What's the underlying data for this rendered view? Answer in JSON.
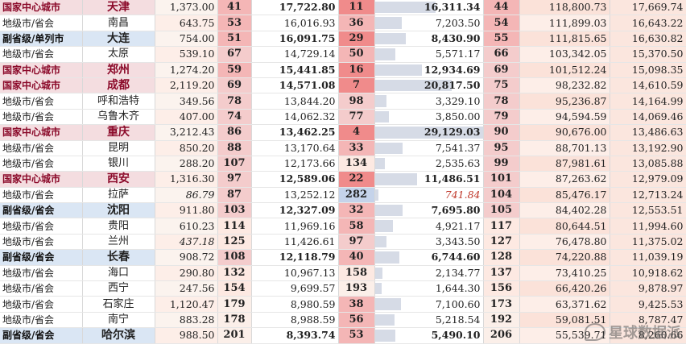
{
  "colors": {
    "national": "#f4dde0",
    "subprov": "#dae6f4",
    "prefect": "#ffffff",
    "rank_high": "#f4cccc",
    "rank_low": "#fde9e2",
    "value_bar": "#d6dbe6"
  },
  "rows": [
    {
      "cat": "国家中心城市",
      "type": "national",
      "city": "天津",
      "v1": "1,373.00",
      "r1": "41",
      "v2": "17,722.80",
      "r2": "11",
      "v3": "16,311.34",
      "r3": "44",
      "v4": "118,800.73",
      "v5": "17,669.74"
    },
    {
      "cat": "地级市/省会",
      "type": "prefect",
      "city": "南昌",
      "v1": "643.75",
      "r1": "53",
      "v2": "16,016.93",
      "r2": "36",
      "v3": "7,203.50",
      "r3": "54",
      "v4": "111,899.03",
      "v5": "16,643.22"
    },
    {
      "cat": "副省级/单列市",
      "type": "subprov",
      "city": "大连",
      "v1": "754.00",
      "r1": "51",
      "v2": "16,091.75",
      "r2": "29",
      "v3": "8,430.90",
      "r3": "55",
      "v4": "111,815.65",
      "v5": "16,630.82"
    },
    {
      "cat": "地级市/省会",
      "type": "prefect",
      "city": "太原",
      "v1": "539.10",
      "r1": "67",
      "v2": "14,729.14",
      "r2": "50",
      "v3": "5,571.17",
      "r3": "66",
      "v4": "103,342.05",
      "v5": "15,370.50"
    },
    {
      "cat": "国家中心城市",
      "type": "national",
      "city": "郑州",
      "v1": "1,274.20",
      "r1": "59",
      "v2": "15,441.85",
      "r2": "16",
      "v3": "12,934.69",
      "r3": "69",
      "v4": "101,512.24",
      "v5": "15,098.35"
    },
    {
      "cat": "国家中心城市",
      "type": "national",
      "city": "成都",
      "v1": "2,119.20",
      "r1": "69",
      "v2": "14,571.08",
      "r2": "7",
      "v3": "20,817.50",
      "r3": "75",
      "v4": "98,232.82",
      "v5": "14,610.59"
    },
    {
      "cat": "地级市/省会",
      "type": "prefect",
      "city": "呼和浩特",
      "v1": "349.56",
      "r1": "78",
      "v2": "13,844.20",
      "r2": "98",
      "v3": "3,329.10",
      "r3": "78",
      "v4": "95,236.87",
      "v5": "14,164.99"
    },
    {
      "cat": "地级市/省会",
      "type": "prefect",
      "city": "乌鲁木齐",
      "v1": "407.00",
      "r1": "74",
      "v2": "14,062.32",
      "r2": "77",
      "v3": "3,850.00",
      "r3": "79",
      "v4": "94,594.59",
      "v5": "14,069.46"
    },
    {
      "cat": "国家中心城市",
      "type": "national",
      "city": "重庆",
      "v1": "3,212.43",
      "r1": "86",
      "v2": "13,462.25",
      "r2": "4",
      "v3": "29,129.03",
      "r3": "90",
      "v4": "90,676.00",
      "v5": "13,486.63"
    },
    {
      "cat": "地级市/省会",
      "type": "prefect",
      "city": "昆明",
      "v1": "850.20",
      "r1": "88",
      "v2": "13,170.64",
      "r2": "33",
      "v3": "7,541.37",
      "r3": "95",
      "v4": "88,701.13",
      "v5": "13,192.90"
    },
    {
      "cat": "地级市/省会",
      "type": "prefect",
      "city": "银川",
      "v1": "288.20",
      "r1": "107",
      "v2": "12,173.66",
      "r2": "134",
      "v3": "2,535.63",
      "r3": "99",
      "v4": "87,981.61",
      "v5": "13,085.88"
    },
    {
      "cat": "国家中心城市",
      "type": "national",
      "city": "西安",
      "v1": "1,316.30",
      "r1": "97",
      "v2": "12,589.06",
      "r2": "22",
      "v3": "11,486.51",
      "r3": "101",
      "v4": "87,263.62",
      "v5": "12,979.09"
    },
    {
      "cat": "地级市/省会",
      "type": "prefect",
      "city": "拉萨",
      "v1": "86.79",
      "r1": "87",
      "v2": "13,252.12",
      "r2": "282",
      "v3": "741.84",
      "r3": "104",
      "v4": "85,476.17",
      "v5": "12,713.24"
    },
    {
      "cat": "副省级/省会",
      "type": "subprov",
      "city": "沈阳",
      "v1": "911.80",
      "r1": "103",
      "v2": "12,327.09",
      "r2": "32",
      "v3": "7,695.80",
      "r3": "105",
      "v4": "84,402.28",
      "v5": "12,553.51"
    },
    {
      "cat": "地级市/省会",
      "type": "prefect",
      "city": "贵阳",
      "v1": "610.23",
      "r1": "114",
      "v2": "11,969.16",
      "r2": "58",
      "v3": "4,921.17",
      "r3": "117",
      "v4": "80,644.51",
      "v5": "11,994.60"
    },
    {
      "cat": "地级市/省会",
      "type": "prefect",
      "city": "兰州",
      "v1": "437.18",
      "r1": "125",
      "v2": "11,426.61",
      "r2": "97",
      "v3": "3,343.50",
      "r3": "127",
      "v4": "76,478.80",
      "v5": "11,375.02"
    },
    {
      "cat": "副省级/省会",
      "type": "subprov",
      "city": "长春",
      "v1": "908.72",
      "r1": "108",
      "v2": "12,118.79",
      "r2": "40",
      "v3": "6,744.60",
      "r3": "128",
      "v4": "74,220.88",
      "v5": "11,039.19"
    },
    {
      "cat": "地级市/省会",
      "type": "prefect",
      "city": "海口",
      "v1": "290.80",
      "r1": "132",
      "v2": "10,967.13",
      "r2": "158",
      "v3": "2,134.77",
      "r3": "137",
      "v4": "73,410.25",
      "v5": "10,918.62"
    },
    {
      "cat": "地级市/省会",
      "type": "prefect",
      "city": "西宁",
      "v1": "247.56",
      "r1": "154",
      "v2": "9,699.57",
      "r2": "193",
      "v3": "1,644.30",
      "r3": "156",
      "v4": "66,420.26",
      "v5": "9,878.97"
    },
    {
      "cat": "地级市/省会",
      "type": "prefect",
      "city": "石家庄",
      "v1": "1,120.47",
      "r1": "179",
      "v2": "8,980.59",
      "r2": "38",
      "v3": "7,100.60",
      "r3": "173",
      "v4": "63,371.62",
      "v5": "9,425.53"
    },
    {
      "cat": "地级市/省会",
      "type": "prefect",
      "city": "南宁",
      "v1": "883.28",
      "r1": "178",
      "v2": "8,988.59",
      "r2": "56",
      "v3": "5,218.54",
      "r3": "192",
      "v4": "59,081.51",
      "v5": "8,787.47"
    },
    {
      "cat": "副省级/省会",
      "type": "subprov",
      "city": "哈尔滨",
      "v1": "988.50",
      "r1": "201",
      "v2": "8,393.74",
      "r2": "53",
      "v3": "5,490.10",
      "r3": "206",
      "v4": "55,539.71",
      "v5": "8,260.66"
    }
  ],
  "watermark": {
    "text": "星球数据派",
    "icon": "wechat-icon"
  }
}
